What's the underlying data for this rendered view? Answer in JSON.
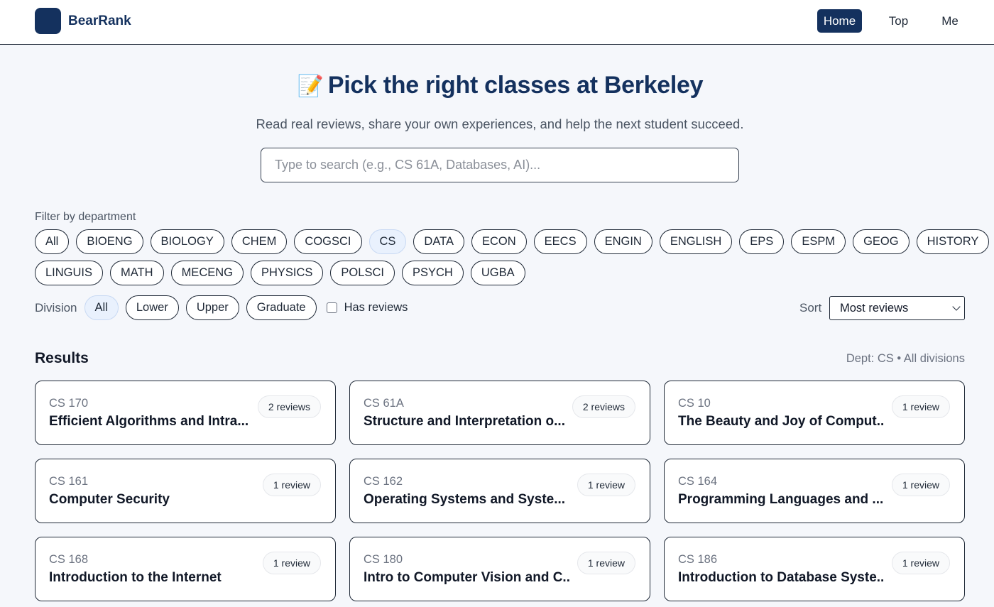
{
  "brand": {
    "name": "BearRank"
  },
  "nav": {
    "home": "Home",
    "top": "Top",
    "me": "Me"
  },
  "hero": {
    "emoji": "📝",
    "title": "Pick the right classes at Berkeley",
    "subtitle": "Read real reviews, share your own experiences, and help the next student succeed."
  },
  "search": {
    "placeholder": "Type to search (e.g., CS 61A, Databases, AI)...",
    "value": ""
  },
  "filters": {
    "department_label": "Filter by department",
    "departments_row1": [
      "All",
      "BIOENG",
      "BIOLOGY",
      "CHEM",
      "COGSCI",
      "CS",
      "DATA",
      "ECON",
      "EECS",
      "ENGIN",
      "ENGLISH",
      "EPS",
      "ESPM",
      "GEOG",
      "HISTORY"
    ],
    "departments_row2": [
      "LINGUIS",
      "MATH",
      "MECENG",
      "PHYSICS",
      "POLSCI",
      "PSYCH",
      "UGBA"
    ],
    "selected_department": "CS",
    "division_label": "Division",
    "divisions": [
      "All",
      "Lower",
      "Upper",
      "Graduate"
    ],
    "selected_division": "All",
    "has_reviews_label": "Has reviews",
    "has_reviews_checked": false,
    "sort_label": "Sort",
    "sort_value": "Most reviews"
  },
  "results": {
    "title": "Results",
    "meta": "Dept: CS • All divisions",
    "courses": [
      {
        "code": "CS 170",
        "name": "Efficient Algorithms and Intra...",
        "reviews": "2 reviews"
      },
      {
        "code": "CS 61A",
        "name": "Structure and Interpretation o...",
        "reviews": "2 reviews"
      },
      {
        "code": "CS 10",
        "name": "The Beauty and Joy of Comput...",
        "reviews": "1 review"
      },
      {
        "code": "CS 161",
        "name": "Computer Security",
        "reviews": "1 review"
      },
      {
        "code": "CS 162",
        "name": "Operating Systems and Syste...",
        "reviews": "1 review"
      },
      {
        "code": "CS 164",
        "name": "Programming Languages and ...",
        "reviews": "1 review"
      },
      {
        "code": "CS 168",
        "name": "Introduction to the Internet",
        "reviews": "1 review"
      },
      {
        "code": "CS 180",
        "name": "Intro to Computer Vision and C...",
        "reviews": "1 review"
      },
      {
        "code": "CS 186",
        "name": "Introduction to Database Syste...",
        "reviews": "1 review"
      }
    ]
  }
}
